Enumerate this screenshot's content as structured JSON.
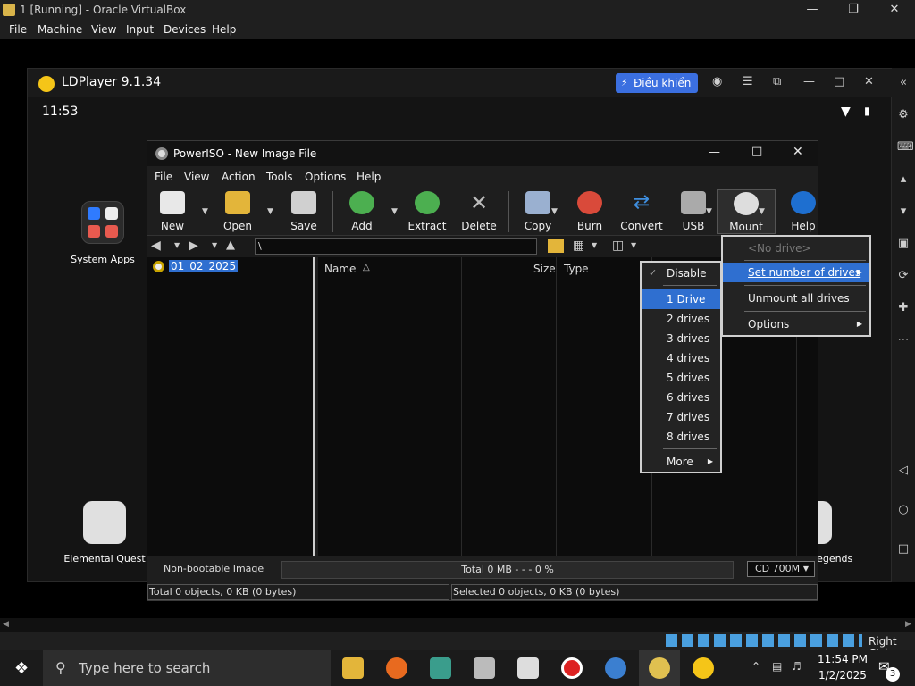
{
  "vbox": {
    "title": "1 [Running] - Oracle VirtualBox",
    "menu": [
      "File",
      "Machine",
      "View",
      "Input",
      "Devices",
      "Help"
    ],
    "status_host_key": "Right Ctrl"
  },
  "ldplayer": {
    "title": "LDPlayer 9.1.34",
    "control_button": "Điều khiển",
    "clock": "11:53",
    "apps": [
      {
        "label": "System Apps"
      },
      {
        "label": "Elemental Quest"
      },
      {
        "label": "y legends"
      }
    ]
  },
  "poweriso": {
    "title": "PowerISO - New Image File",
    "menu": [
      "File",
      "View",
      "Action",
      "Tools",
      "Options",
      "Help"
    ],
    "toolbar": [
      {
        "label": "New",
        "icon": "new-file-icon"
      },
      {
        "label": "Open",
        "icon": "open-folder-icon"
      },
      {
        "label": "Save",
        "icon": "save-disk-icon"
      },
      {
        "label": "Add",
        "icon": "add-icon"
      },
      {
        "label": "Extract",
        "icon": "extract-icon"
      },
      {
        "label": "Delete",
        "icon": "delete-icon"
      },
      {
        "label": "Copy",
        "icon": "copy-disc-icon"
      },
      {
        "label": "Burn",
        "icon": "burn-icon"
      },
      {
        "label": "Convert",
        "icon": "convert-icon"
      },
      {
        "label": "USB",
        "icon": "usb-icon"
      },
      {
        "label": "Mount",
        "icon": "mount-icon"
      },
      {
        "label": "Help",
        "icon": "help-icon"
      }
    ],
    "path": "\\",
    "tree_item": "01_02_2025",
    "columns": {
      "name": "Name",
      "size": "Size",
      "type": "Type"
    },
    "bootable": "Non-bootable Image",
    "total_bar": "Total  0 MB   - - -  0 %",
    "disc_type": "CD 700M",
    "status_total": "Total 0 objects, 0 KB (0 bytes)",
    "status_selected": "Selected 0 objects, 0 KB (0 bytes)"
  },
  "mount_menu": {
    "no_drive": "<No drive>",
    "set_number": "Set number of drives",
    "unmount_all": "Unmount all drives",
    "options": "Options"
  },
  "drives_submenu": {
    "items": [
      "Disable",
      "1 Drive",
      "2 drives",
      "3 drives",
      "4 drives",
      "5 drives",
      "6 drives",
      "7 drives",
      "8 drives",
      "More"
    ]
  },
  "taskbar": {
    "search_placeholder": "Type here to search",
    "time": "11:54 PM",
    "date": "1/2/2025",
    "notifications": "3"
  }
}
